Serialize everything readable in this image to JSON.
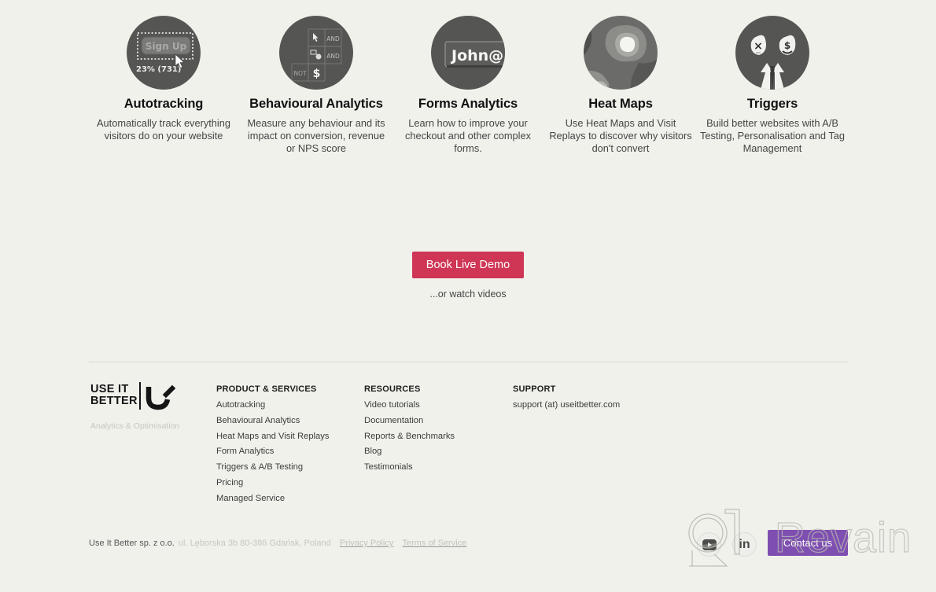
{
  "features": [
    {
      "id": "autotracking",
      "icon": "autotracking-signup-icon",
      "icon_text": {
        "button": "Sign Up",
        "stat": "23% (731)"
      },
      "title": "Autotracking",
      "description": "Automatically track everything visitors do on your website"
    },
    {
      "id": "behavioural-analytics",
      "icon": "behaviour-logic-grid-icon",
      "icon_text": {
        "and1": "AND",
        "and2": "AND",
        "not": "NOT",
        "dollar": "$"
      },
      "title": "Behavioural Analytics",
      "description": "Measure any behaviour and its impact on conversion, revenue or NPS score"
    },
    {
      "id": "forms-analytics",
      "icon": "form-field-icon",
      "icon_text": {
        "field": "John@"
      },
      "title": "Forms Analytics",
      "description": "Learn how to improve your checkout and other complex forms."
    },
    {
      "id": "heat-maps",
      "icon": "heatmap-icon",
      "title": "Heat Maps",
      "description": "Use Heat Maps and Visit Replays to discover why visitors don't convert"
    },
    {
      "id": "triggers",
      "icon": "triggers-faces-icon",
      "icon_text": {
        "x": "×",
        "dollar": "$"
      },
      "title": "Triggers",
      "description": "Build better websites with A/B Testing, Personalisation and Tag Management"
    }
  ],
  "cta": {
    "primary_label": "Book Live Demo",
    "primary_color": "#cf3554",
    "secondary_label": "...or watch videos"
  },
  "footer": {
    "logo": {
      "line1": "USE IT",
      "line2": "BETTER"
    },
    "tagline": "Analytics & Optimisation",
    "columns": [
      {
        "heading": "PRODUCT & SERVICES",
        "items": [
          "Autotracking",
          "Behavioural Analytics",
          "Heat Maps and Visit Replays",
          "Form Analytics",
          "Triggers & A/B Testing",
          "Pricing",
          "Managed Service"
        ]
      },
      {
        "heading": "RESOURCES",
        "items": [
          "Video tutorials",
          "Documentation",
          "Reports & Benchmarks",
          "Blog",
          "Testimonials"
        ]
      },
      {
        "heading": "SUPPORT",
        "items": [
          "support (at) useitbetter.com"
        ]
      }
    ],
    "legal": {
      "company": "Use It Better sp. z o.o.",
      "address": "ul. Lęborska 3b 80-386 Gdańsk, Poland",
      "privacy": "Privacy Policy",
      "terms": "Terms of Service"
    },
    "social": {
      "youtube": "youtube-icon",
      "linkedin": "in"
    },
    "contact_label": "Contact us",
    "contact_color": "#7e4fb0"
  },
  "watermark": {
    "text": "Revain"
  }
}
